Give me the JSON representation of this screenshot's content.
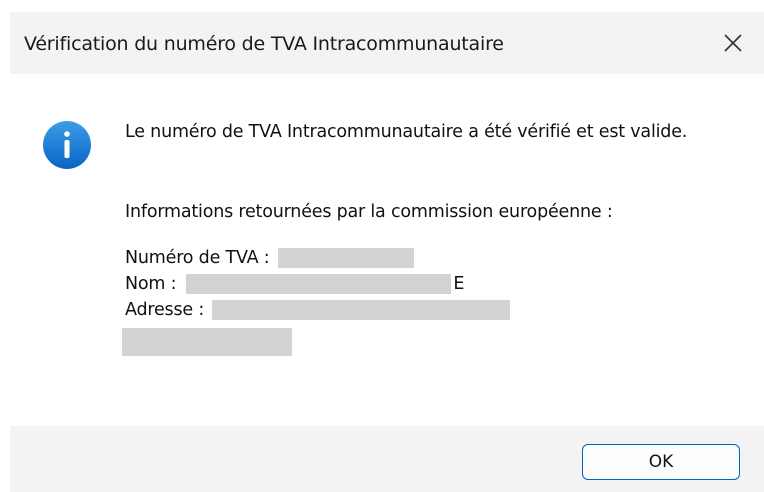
{
  "dialog": {
    "title": "Vérification du numéro de TVA Intracommunautaire",
    "icon": "info-icon",
    "accent_color": "#0067c0",
    "message": "Le numéro de TVA Intracommunautaire a été vérifié et est valide.",
    "info_heading": "Informations retournées par la commission européenne :",
    "fields": {
      "vat_label": "Numéro de TVA :",
      "name_label": "Nom :",
      "name_trailing": "E",
      "address_label": "Adresse :"
    },
    "ok_label": "OK"
  }
}
